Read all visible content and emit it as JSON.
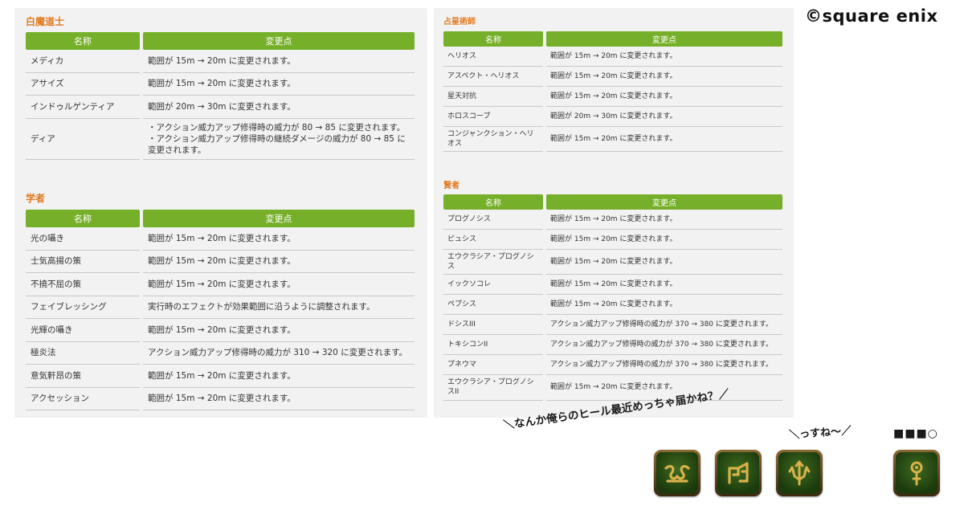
{
  "copyright": "©square enix",
  "left_panel": {
    "sections": [
      {
        "title": "白魔道士",
        "headers": [
          "名称",
          "変更点"
        ],
        "rows": [
          {
            "name": "メディカ",
            "change": "範囲が 15m → 20m に変更されます。"
          },
          {
            "name": "アサイズ",
            "change": "範囲が 15m → 20m に変更されます。"
          },
          {
            "name": "インドゥルゲンティア",
            "change": "範囲が 20m → 30m に変更されます。"
          },
          {
            "name": "ディア",
            "change": "・アクション威力アップ修得時の威力が 80 → 85 に変更されます。\n・アクション威力アップ修得時の継続ダメージの威力が 80 → 85 に変更されます。"
          }
        ]
      },
      {
        "title": "学者",
        "headers": [
          "名称",
          "変更点"
        ],
        "rows": [
          {
            "name": "光の囁き",
            "change": "範囲が 15m → 20m に変更されます。"
          },
          {
            "name": "士気高揚の策",
            "change": "範囲が 15m → 20m に変更されます。"
          },
          {
            "name": "不撓不屈の策",
            "change": "範囲が 15m → 20m に変更されます。"
          },
          {
            "name": "フェイブレッシング",
            "change": "実行時のエフェクトが効果範囲に沿うように調整されます。"
          },
          {
            "name": "光輝の囁き",
            "change": "範囲が 15m → 20m に変更されます。"
          },
          {
            "name": "極炎法",
            "change": "アクション威力アップ修得時の威力が 310 → 320 に変更されます。"
          },
          {
            "name": "意気軒昂の策",
            "change": "範囲が 15m → 20m に変更されます。"
          },
          {
            "name": "アクセッション",
            "change": "範囲が 15m → 20m に変更されます。"
          }
        ]
      }
    ]
  },
  "right_panel": {
    "sections": [
      {
        "title": "占星術師",
        "headers": [
          "名称",
          "変更点"
        ],
        "rows": [
          {
            "name": "ヘリオス",
            "change": "範囲が 15m → 20m に変更されます。"
          },
          {
            "name": "アスペクト・ヘリオス",
            "change": "範囲が 15m → 20m に変更されます。"
          },
          {
            "name": "星天対抗",
            "change": "範囲が 15m → 20m に変更されます。"
          },
          {
            "name": "ホロスコープ",
            "change": "範囲が 20m → 30m に変更されます。"
          },
          {
            "name": "コンジャンクション・ヘリオス",
            "change": "範囲が 15m → 20m に変更されます。"
          }
        ]
      },
      {
        "title": "賢者",
        "headers": [
          "名称",
          "変更点"
        ],
        "rows": [
          {
            "name": "プログノシス",
            "change": "範囲が 15m → 20m に変更されます。"
          },
          {
            "name": "ピュシス",
            "change": "範囲が 15m → 20m に変更されます。"
          },
          {
            "name": "エウクラシア・プログノシス",
            "change": "範囲が 15m → 20m に変更されます。"
          },
          {
            "name": "イックソコレ",
            "change": "範囲が 15m → 20m に変更されます。"
          },
          {
            "name": "ペプシス",
            "change": "範囲が 15m → 20m に変更されます。"
          },
          {
            "name": "ドシスIII",
            "change": "アクション威力アップ修得時の威力が 370 → 380 に変更されます。"
          },
          {
            "name": "トキシコンII",
            "change": "アクション威力アップ修得時の威力が 370 → 380 に変更されます。"
          },
          {
            "name": "プネウマ",
            "change": "アクション威力アップ修得時の威力が 370 → 380 に変更されます。"
          },
          {
            "name": "エウクラシア・プログノシスII",
            "change": "範囲が 15m → 20m に変更されます。"
          }
        ]
      }
    ]
  },
  "speech": {
    "line1": "＼なんか俺らのヒール最近めっちゃ届かね？／",
    "line2": "＼っすね～／",
    "line3": "■■■○"
  },
  "icons": [
    {
      "name": "white-mage-job-icon",
      "color": "#c9a442"
    },
    {
      "name": "scholar-job-icon",
      "color": "#c9a442"
    },
    {
      "name": "sage-job-icon",
      "color": "#c9a442"
    },
    {
      "name": "astrologian-job-icon",
      "color": "#c9a442"
    }
  ]
}
